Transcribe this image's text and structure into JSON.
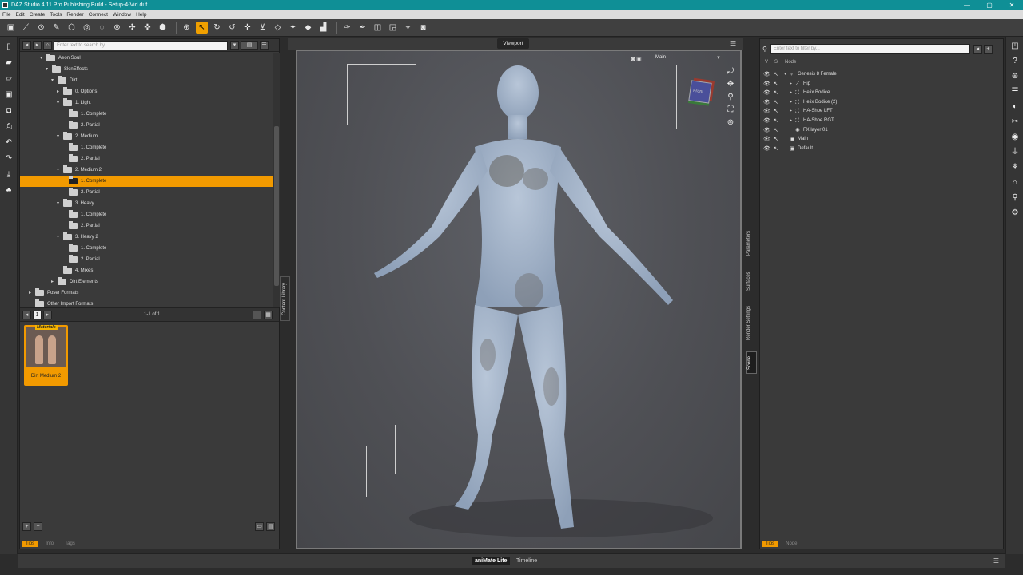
{
  "window": {
    "title": "DAZ Studio 4.11 Pro Publishing Build - Setup-4-Vid.duf",
    "controls": [
      "—",
      "▢",
      "✕"
    ]
  },
  "menu": [
    "File",
    "Edit",
    "Create",
    "Tools",
    "Render",
    "Connect",
    "Window",
    "Help"
  ],
  "content_library": {
    "search_placeholder": "Enter text to search by...",
    "tree": [
      {
        "label": "Aeon Soul",
        "depth": 3,
        "arrow": "▾"
      },
      {
        "label": "SkinEffects",
        "depth": 4,
        "arrow": "▾"
      },
      {
        "label": "Dirt",
        "depth": 5,
        "arrow": "▾"
      },
      {
        "label": "0. Options",
        "depth": 6,
        "arrow": "▸"
      },
      {
        "label": "1. Light",
        "depth": 6,
        "arrow": "▾"
      },
      {
        "label": "1. Complete",
        "depth": 7,
        "arrow": ""
      },
      {
        "label": "2. Partial",
        "depth": 7,
        "arrow": ""
      },
      {
        "label": "2. Medium",
        "depth": 6,
        "arrow": "▾"
      },
      {
        "label": "1. Complete",
        "depth": 7,
        "arrow": ""
      },
      {
        "label": "2. Partial",
        "depth": 7,
        "arrow": ""
      },
      {
        "label": "2. Medium 2",
        "depth": 6,
        "arrow": "▾"
      },
      {
        "label": "1. Complete",
        "depth": 7,
        "arrow": "",
        "selected": true
      },
      {
        "label": "2. Partial",
        "depth": 7,
        "arrow": ""
      },
      {
        "label": "3. Heavy",
        "depth": 6,
        "arrow": "▾"
      },
      {
        "label": "1. Complete",
        "depth": 7,
        "arrow": ""
      },
      {
        "label": "2. Partial",
        "depth": 7,
        "arrow": ""
      },
      {
        "label": "3. Heavy 2",
        "depth": 6,
        "arrow": "▾"
      },
      {
        "label": "1. Complete",
        "depth": 7,
        "arrow": ""
      },
      {
        "label": "2. Partial",
        "depth": 7,
        "arrow": ""
      },
      {
        "label": "4. Mixes",
        "depth": 6,
        "arrow": ""
      },
      {
        "label": "Dirt Elements",
        "depth": 5,
        "arrow": "▸"
      },
      {
        "label": "Poser Formats",
        "depth": 1,
        "arrow": "▸"
      },
      {
        "label": "Other Import Formats",
        "depth": 1,
        "arrow": ""
      }
    ],
    "page_number": "1",
    "page_count": "1-1 of 1",
    "asset": {
      "badge": "Materials",
      "name": "Dirt Medium 2"
    },
    "bottom_tabs": [
      "Tips",
      "Info",
      "Tags"
    ],
    "side_tab": "Content Library"
  },
  "viewport": {
    "title": "Viewport",
    "camera": "Main",
    "navcube_label": "Front"
  },
  "side_tabs": [
    "Parameters",
    "Surfaces",
    "Render Settings",
    "Scene"
  ],
  "scene": {
    "filter_placeholder": "Enter text to filter by...",
    "headers": [
      "V",
      "S",
      "Node"
    ],
    "nodes": [
      {
        "label": "Genesis 8 Female",
        "indent": 0,
        "arrow": "▾",
        "icon": "figure"
      },
      {
        "label": "Hip",
        "indent": 1,
        "arrow": "▸",
        "icon": "bone"
      },
      {
        "label": "Helix Bodice",
        "indent": 1,
        "arrow": "▸",
        "icon": "prop"
      },
      {
        "label": "Helix Bodice (2)",
        "indent": 1,
        "arrow": "▸",
        "icon": "prop"
      },
      {
        "label": "HA-Shoe LFT",
        "indent": 1,
        "arrow": "▸",
        "icon": "prop"
      },
      {
        "label": "HA-Shoe RGT",
        "indent": 1,
        "arrow": "▸",
        "icon": "prop"
      },
      {
        "label": "FX layer 01",
        "indent": 1,
        "arrow": "",
        "icon": "fx"
      },
      {
        "label": "Main",
        "indent": 0,
        "arrow": "",
        "icon": "camera"
      },
      {
        "label": "Default",
        "indent": 0,
        "arrow": "",
        "icon": "camera"
      }
    ],
    "bottom_tabs": [
      "Tips",
      "Node"
    ]
  },
  "bottom_tabs": [
    "aniMate Lite",
    "Timeline"
  ],
  "colors": {
    "accent": "#f29a00",
    "titlebar": "#0f8f96"
  }
}
